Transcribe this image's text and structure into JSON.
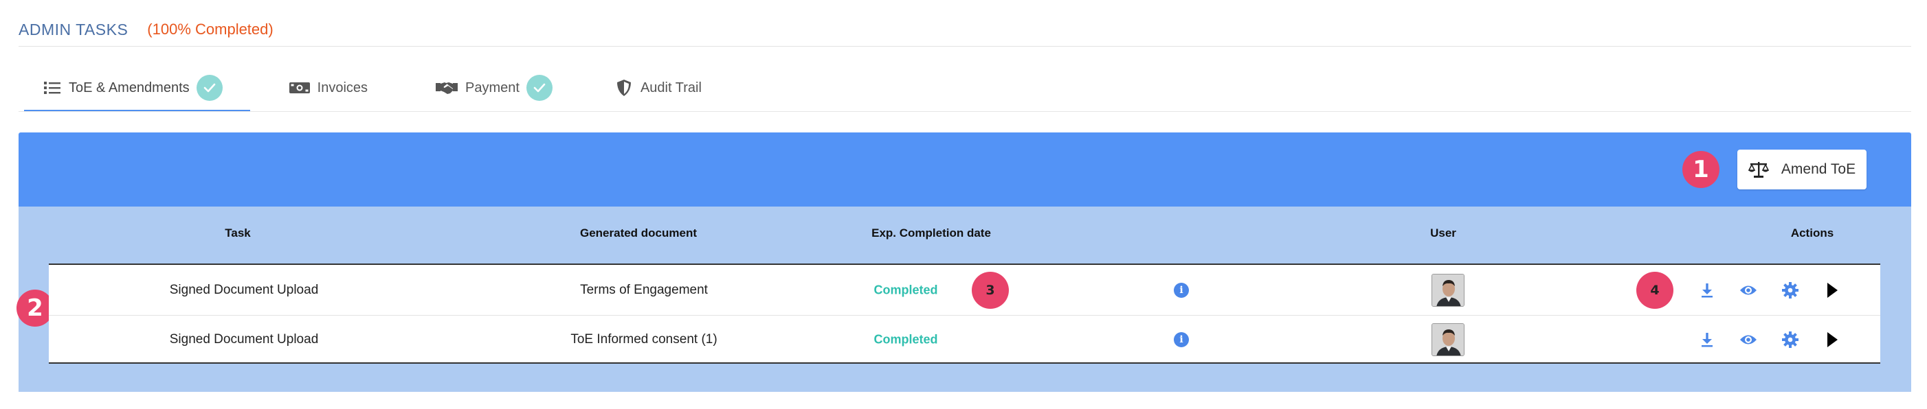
{
  "header": {
    "title": "ADMIN TASKS",
    "progress": "(100% Completed)"
  },
  "tabs": [
    {
      "label": "ToE & Amendments",
      "icon": "list-icon",
      "completed": true,
      "active": true
    },
    {
      "label": "Invoices",
      "icon": "money-bill-icon",
      "completed": false,
      "active": false
    },
    {
      "label": "Payment",
      "icon": "handshake-icon",
      "completed": true,
      "active": false
    },
    {
      "label": "Audit Trail",
      "icon": "shield-icon",
      "completed": false,
      "active": false
    }
  ],
  "toolbar": {
    "amend_label": "Amend ToE",
    "amend_icon": "balance-scale-icon"
  },
  "callouts": [
    "1",
    "2",
    "3",
    "4"
  ],
  "table": {
    "columns": [
      "Task",
      "Generated document",
      "Exp. Completion date",
      "User",
      "Actions"
    ],
    "rows": [
      {
        "task": "Signed Document Upload",
        "document": "Terms of Engagement",
        "status": "Completed"
      },
      {
        "task": "Signed Document Upload",
        "document": "ToE Informed consent (1)",
        "status": "Completed"
      }
    ],
    "action_icons": [
      "download-icon",
      "eye-icon",
      "gear-icon",
      "play-icon"
    ]
  },
  "colors": {
    "panel_top": "#5393f6",
    "panel_body": "#aecbf2",
    "accent": "#4f8ff0",
    "badge": "#e8436a",
    "completed": "#2fbfae",
    "progress": "#e8571e"
  }
}
